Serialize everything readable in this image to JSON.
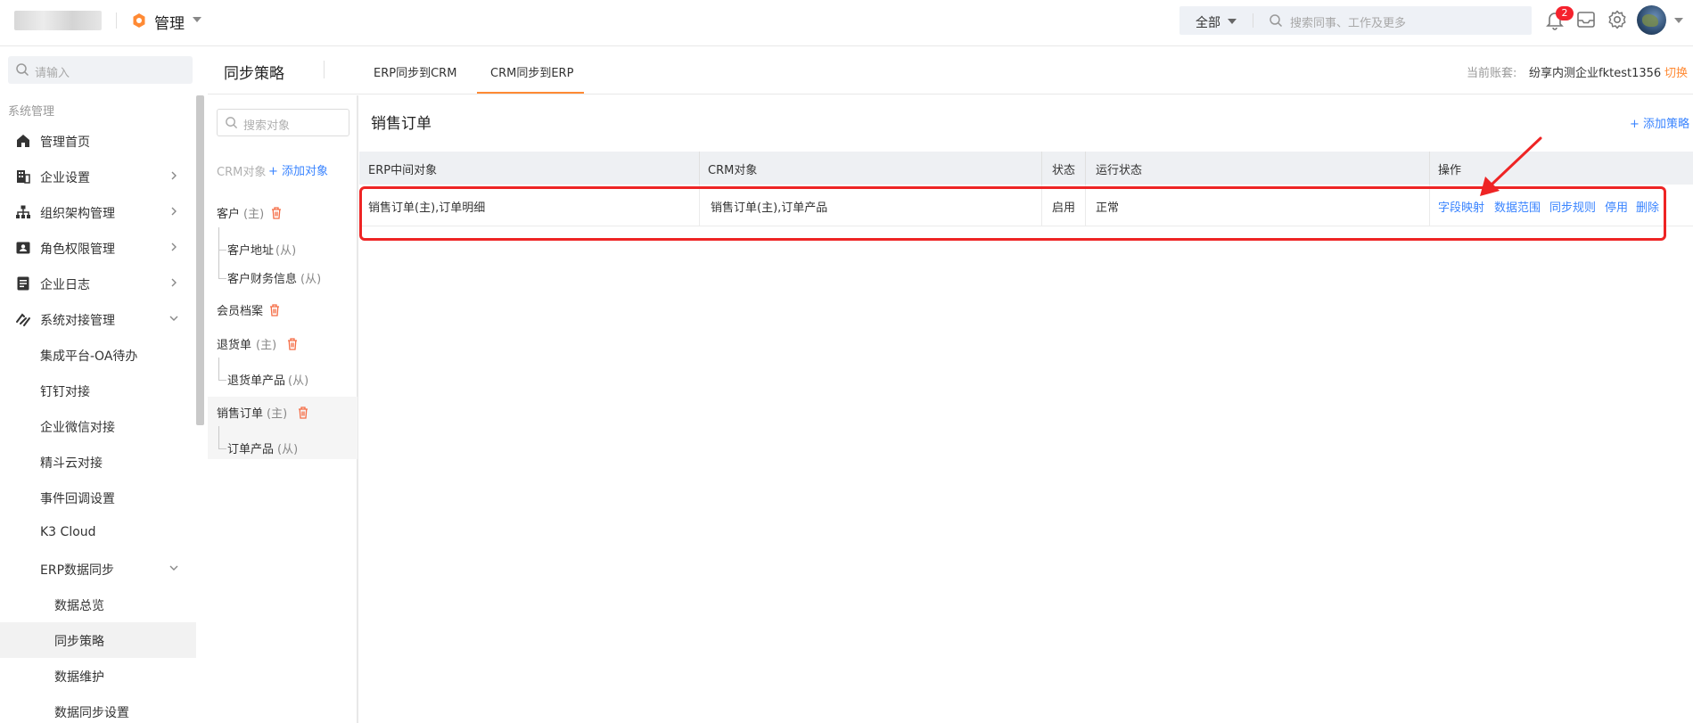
{
  "topbar": {
    "app_name": "管理",
    "search_scope": "全部",
    "search_placeholder": "搜索同事、工作及更多",
    "notification_count": "2",
    "accent_color": "#ff8a34"
  },
  "sidebar": {
    "search_placeholder": "请输入",
    "group_title": "系统管理",
    "items": [
      {
        "label": "管理首页",
        "icon": "home-icon"
      },
      {
        "label": "企业设置",
        "icon": "building-icon"
      },
      {
        "label": "组织架构管理",
        "icon": "org-chart-icon"
      },
      {
        "label": "角色权限管理",
        "icon": "id-card-icon"
      },
      {
        "label": "企业日志",
        "icon": "log-icon"
      },
      {
        "label": "系统对接管理",
        "icon": "link-icon"
      }
    ],
    "sub_items": [
      {
        "label": "集成平台-OA待办"
      },
      {
        "label": "钉钉对接"
      },
      {
        "label": "企业微信对接"
      },
      {
        "label": "精斗云对接"
      },
      {
        "label": "事件回调设置"
      },
      {
        "label": "K3 Cloud"
      },
      {
        "label": "ERP数据同步"
      }
    ],
    "erp_sub_items": [
      {
        "label": "数据总览"
      },
      {
        "label": "同步策略"
      },
      {
        "label": "数据维护"
      },
      {
        "label": "数据同步设置"
      }
    ]
  },
  "header": {
    "title": "同步策略",
    "tabs": [
      {
        "label": "ERP同步到CRM"
      },
      {
        "label": "CRM同步到ERP"
      }
    ],
    "account_label": "当前账套:",
    "account_name": "纷享内测企业fktest1356",
    "switch_label": "切换"
  },
  "objects": {
    "search_placeholder": "搜索对象",
    "section_label": "CRM对象",
    "add_label": "+ 添加对象",
    "list": [
      {
        "name": "客户",
        "role": "(主)"
      },
      {
        "name": "客户地址",
        "role": "(从)"
      },
      {
        "name": "客户财务信息",
        "role": "(从)"
      },
      {
        "name": "会员档案",
        "role": ""
      },
      {
        "name": "退货单",
        "role": "(主)"
      },
      {
        "name": "退货单产品",
        "role": "(从)"
      },
      {
        "name": "销售订单",
        "role": "(主)"
      },
      {
        "name": "订单产品",
        "role": "(从)"
      }
    ]
  },
  "detail": {
    "title": "销售订单",
    "add_policy": "+ 添加策略",
    "columns": [
      "ERP中间对象",
      "CRM对象",
      "状态",
      "运行状态",
      "操作"
    ],
    "rows": [
      {
        "erp_object": "销售订单(主),订单明细",
        "crm_object": "销售订单(主),订单产品",
        "status": "启用",
        "run_status": "正常",
        "actions": [
          "字段映射",
          "数据范围",
          "同步规则",
          "停用",
          "删除"
        ]
      }
    ],
    "highlight_color": "#ee2424",
    "link_color": "#3a84ff"
  }
}
